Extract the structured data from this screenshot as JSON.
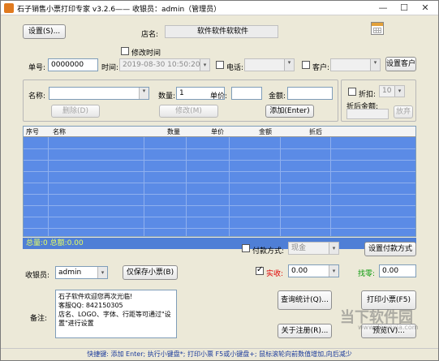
{
  "window": {
    "title": "石子销售小票打印专家 v3.2.6—— 收银员：admin（管理员）",
    "min_label": "—",
    "max_label": "☐",
    "close_label": "✕"
  },
  "top": {
    "settings_button": "设置(S)...",
    "store_label": "店名:",
    "store_value": "软件软件软软件",
    "modify_time_label": "修改时间",
    "order_label": "单号:",
    "order_value": "0000000",
    "time_label": "时间:",
    "time_value": "2019-08-30 10:50:20",
    "phone_label": "电话:",
    "customer_label": "客户:",
    "customer_settings_button": "设置客户"
  },
  "entry": {
    "name_label": "名称:",
    "qty_label": "数量:",
    "qty_value": "1",
    "price_label": "单价:",
    "amount_label": "金额:",
    "delete_button": "删除(D)",
    "modify_button": "修改(M)",
    "add_button": "添加(Enter)",
    "discount_label": "折扣:",
    "discount_value": "10",
    "discounted_amount_label": "折后金额:",
    "discard_button": "放弃"
  },
  "grid": {
    "columns": [
      "序号",
      "名称",
      "数量",
      "单价",
      "金额",
      "折后"
    ]
  },
  "totals": {
    "text": "总量:0  总额:0.00"
  },
  "payment": {
    "payment_method_label": "付款方式:",
    "payment_method_value": "现金",
    "set_payment_button": "设置付款方式",
    "cashier_label": "收银员:",
    "cashier_value": "admin",
    "save_ticket_button": "仅保存小票(B)",
    "received_label": "实收:",
    "received_value": "0.00",
    "change_label": "找零:",
    "change_value": "0.00"
  },
  "notes": {
    "label": "备注:",
    "text": "石子软件欢迎您再次光临!\n客服QQ: 842150305\n店名、LOGO、字体、行距等可通过\"设置\"进行设置"
  },
  "actions": {
    "query_stats_button": "查询统计(Q)...",
    "print_button": "打印小票(F5)",
    "about_button": "关于注册(R)...",
    "preview_button": "预览(V)..."
  },
  "status": {
    "text": "快捷键: 添加 Enter; 执行小键盘*; 打印小票 F5或小键盘+; 鼠标滚轮向前数值增加,向后减少"
  },
  "watermark": {
    "text": "当下软件园",
    "sub": "www.downxia.com"
  },
  "icons": {
    "calendar": "calendar-icon",
    "app": "receipt-app-icon"
  }
}
